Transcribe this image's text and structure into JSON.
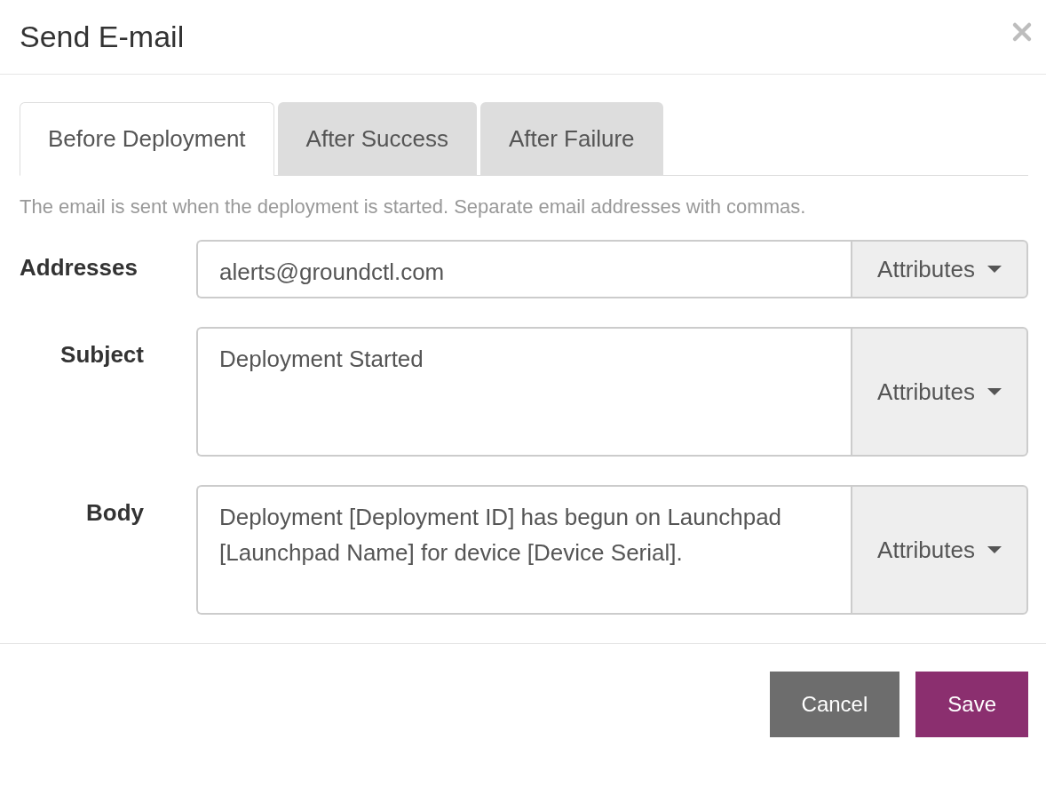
{
  "dialog": {
    "title": "Send E-mail"
  },
  "tabs": [
    {
      "label": "Before Deployment",
      "selected": true
    },
    {
      "label": "After Success",
      "selected": false
    },
    {
      "label": "After Failure",
      "selected": false
    }
  ],
  "help_text": "The email is sent when the deployment is started. Separate email addresses with commas.",
  "fields": [
    {
      "label": "Addresses",
      "kind": "single",
      "value": "alerts@groundctl.com",
      "addon": "Attributes"
    },
    {
      "label": "Subject",
      "kind": "multi",
      "value": "Deployment Started",
      "addon": "Attributes"
    },
    {
      "label": "Body",
      "kind": "multi",
      "value": "Deployment [Deployment ID] has begun on Launchpad [Launchpad Name] for device [Device Serial].",
      "addon": "Attributes"
    }
  ],
  "buttons": [
    {
      "label": "Cancel",
      "kind": "secondary"
    },
    {
      "label": "Save",
      "kind": "primary"
    }
  ]
}
